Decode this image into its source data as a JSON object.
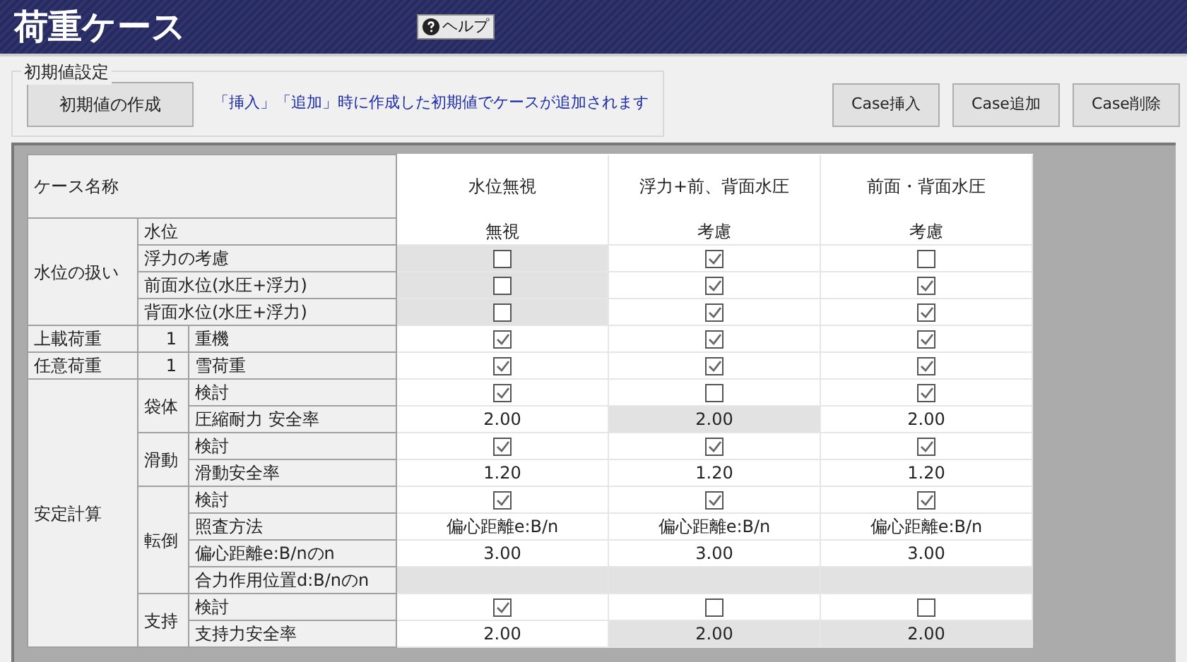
{
  "title": "荷重ケース",
  "help_button": "ヘルプ",
  "initial_settings": {
    "legend": "初期値設定",
    "create_button": "初期値の作成",
    "note": "「挿入」「追加」時に作成した初期値でケースが追加されます"
  },
  "case_buttons": [
    "Case挿入",
    "Case追加",
    "Case削除"
  ],
  "table": {
    "header_label": "ケース名称",
    "columns": [
      "水位無視",
      "浮力+前、背面水圧",
      "前面・背面水圧"
    ],
    "sections": [
      {
        "label": "水位の扱い",
        "items": [
          {
            "label": "水位",
            "cells": [
              {
                "kind": "text",
                "text": "無視",
                "shaded": false
              },
              {
                "kind": "text",
                "text": "考慮",
                "shaded": false
              },
              {
                "kind": "text",
                "text": "考慮",
                "shaded": false
              }
            ]
          },
          {
            "label": "浮力の考慮",
            "cells": [
              {
                "kind": "check",
                "checked": false,
                "shaded": true
              },
              {
                "kind": "check",
                "checked": true,
                "shaded": false
              },
              {
                "kind": "check",
                "checked": false,
                "shaded": false
              }
            ]
          },
          {
            "label": "前面水位(水圧+浮力)",
            "cells": [
              {
                "kind": "check",
                "checked": false,
                "shaded": true
              },
              {
                "kind": "check",
                "checked": true,
                "shaded": false
              },
              {
                "kind": "check",
                "checked": true,
                "shaded": false
              }
            ]
          },
          {
            "label": "背面水位(水圧+浮力)",
            "cells": [
              {
                "kind": "check",
                "checked": false,
                "shaded": true
              },
              {
                "kind": "check",
                "checked": true,
                "shaded": false
              },
              {
                "kind": "check",
                "checked": true,
                "shaded": false
              }
            ]
          }
        ]
      },
      {
        "label": "上載荷重",
        "number": "1",
        "items": [
          {
            "label": "重機",
            "cells": [
              {
                "kind": "check",
                "checked": true,
                "shaded": false
              },
              {
                "kind": "check",
                "checked": true,
                "shaded": false
              },
              {
                "kind": "check",
                "checked": true,
                "shaded": false
              }
            ]
          }
        ]
      },
      {
        "label": "任意荷重",
        "number": "1",
        "items": [
          {
            "label": "雪荷重",
            "cells": [
              {
                "kind": "check",
                "checked": true,
                "shaded": false
              },
              {
                "kind": "check",
                "checked": true,
                "shaded": false
              },
              {
                "kind": "check",
                "checked": true,
                "shaded": false
              }
            ]
          }
        ]
      },
      {
        "label": "安定計算",
        "groups": [
          {
            "label": "袋体",
            "items": [
              {
                "label": "検討",
                "cells": [
                  {
                    "kind": "check",
                    "checked": true,
                    "shaded": false
                  },
                  {
                    "kind": "check",
                    "checked": false,
                    "shaded": false
                  },
                  {
                    "kind": "check",
                    "checked": true,
                    "shaded": false
                  }
                ]
              },
              {
                "label": "圧縮耐力 安全率",
                "cells": [
                  {
                    "kind": "text",
                    "text": "2.00",
                    "shaded": false
                  },
                  {
                    "kind": "text",
                    "text": "2.00",
                    "shaded": true
                  },
                  {
                    "kind": "text",
                    "text": "2.00",
                    "shaded": false
                  }
                ]
              }
            ]
          },
          {
            "label": "滑動",
            "items": [
              {
                "label": "検討",
                "cells": [
                  {
                    "kind": "check",
                    "checked": true,
                    "shaded": false
                  },
                  {
                    "kind": "check",
                    "checked": true,
                    "shaded": false
                  },
                  {
                    "kind": "check",
                    "checked": true,
                    "shaded": false
                  }
                ]
              },
              {
                "label": "滑動安全率",
                "cells": [
                  {
                    "kind": "text",
                    "text": "1.20",
                    "shaded": false
                  },
                  {
                    "kind": "text",
                    "text": "1.20",
                    "shaded": false
                  },
                  {
                    "kind": "text",
                    "text": "1.20",
                    "shaded": false
                  }
                ]
              }
            ]
          },
          {
            "label": "転倒",
            "items": [
              {
                "label": "検討",
                "cells": [
                  {
                    "kind": "check",
                    "checked": true,
                    "shaded": false
                  },
                  {
                    "kind": "check",
                    "checked": true,
                    "shaded": false
                  },
                  {
                    "kind": "check",
                    "checked": true,
                    "shaded": false
                  }
                ]
              },
              {
                "label": "照査方法",
                "cells": [
                  {
                    "kind": "text",
                    "text": "偏心距離e:B/n",
                    "shaded": false
                  },
                  {
                    "kind": "text",
                    "text": "偏心距離e:B/n",
                    "shaded": false
                  },
                  {
                    "kind": "text",
                    "text": "偏心距離e:B/n",
                    "shaded": false
                  }
                ]
              },
              {
                "label": "偏心距離e:B/nのn",
                "cells": [
                  {
                    "kind": "text",
                    "text": "3.00",
                    "shaded": false
                  },
                  {
                    "kind": "text",
                    "text": "3.00",
                    "shaded": false
                  },
                  {
                    "kind": "text",
                    "text": "3.00",
                    "shaded": false
                  }
                ]
              },
              {
                "label": "合力作用位置d:B/nのn",
                "cells": [
                  {
                    "kind": "empty",
                    "shaded": true
                  },
                  {
                    "kind": "empty",
                    "shaded": true
                  },
                  {
                    "kind": "empty",
                    "shaded": true
                  }
                ]
              }
            ]
          },
          {
            "label": "支持",
            "items": [
              {
                "label": "検討",
                "cells": [
                  {
                    "kind": "check",
                    "checked": true,
                    "shaded": false
                  },
                  {
                    "kind": "check",
                    "checked": false,
                    "shaded": false
                  },
                  {
                    "kind": "check",
                    "checked": false,
                    "shaded": false
                  }
                ]
              },
              {
                "label": "支持力安全率",
                "cells": [
                  {
                    "kind": "text",
                    "text": "2.00",
                    "shaded": false
                  },
                  {
                    "kind": "text",
                    "text": "2.00",
                    "shaded": true
                  },
                  {
                    "kind": "text",
                    "text": "2.00",
                    "shaded": true
                  }
                ]
              }
            ]
          }
        ]
      }
    ]
  }
}
